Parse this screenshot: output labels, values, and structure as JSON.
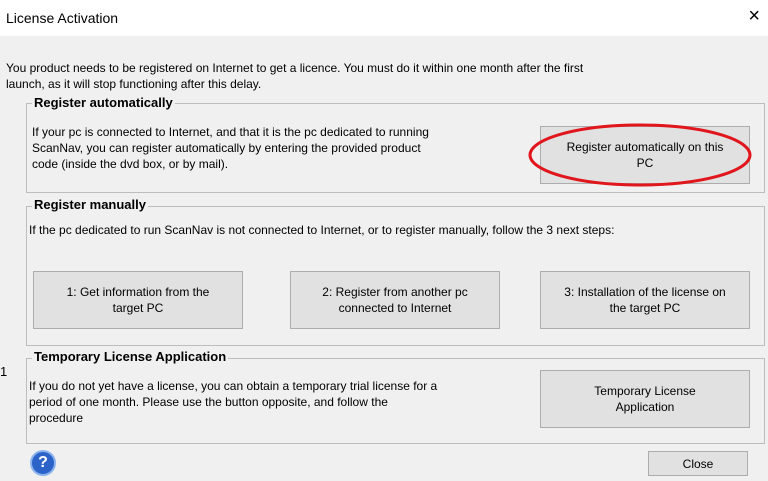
{
  "dialog": {
    "title": "License Activation",
    "close_glyph": "×",
    "intro_line1": "You product needs to be registered on Internet to get a licence. You must do it within one month after the first",
    "intro_line2": "launch, as it will stop functioning after this delay.",
    "margin_glyph": "1"
  },
  "register_auto": {
    "legend": "Register automatically",
    "desc_line1": "If your pc is connected to Internet, and that it is the pc dedicated to running",
    "desc_line2": "ScanNav, you can register automatically by entering the provided product",
    "desc_line3": "code (inside the dvd box, or by mail).",
    "button": "Register automatically on this\nPC",
    "highlight_color": "#e0161c"
  },
  "register_manual": {
    "legend": "Register manually",
    "desc": "If the pc dedicated to run ScanNav is not connected to Internet, or to register manually, follow the 3 next steps:",
    "step1": "1: Get information from the\ntarget PC",
    "step2": "2: Register from another pc\nconnected to Internet",
    "step3": "3: Installation of the license on\nthe target PC"
  },
  "temporary": {
    "legend": "Temporary License Application",
    "desc_line1": "If you do not yet have a license, you can obtain a temporary trial license for a",
    "desc_line2": "period of one month. Please use the button opposite, and follow the",
    "desc_line3": "procedure",
    "button": "Temporary License\nApplication"
  },
  "footer": {
    "help_icon": "question-mark-icon",
    "help_glyph": "?",
    "close_button": "Close"
  },
  "colors": {
    "window_bg": "#f0f0f0",
    "button_bg": "#e1e1e1",
    "help_blue": "#2b63c8"
  }
}
